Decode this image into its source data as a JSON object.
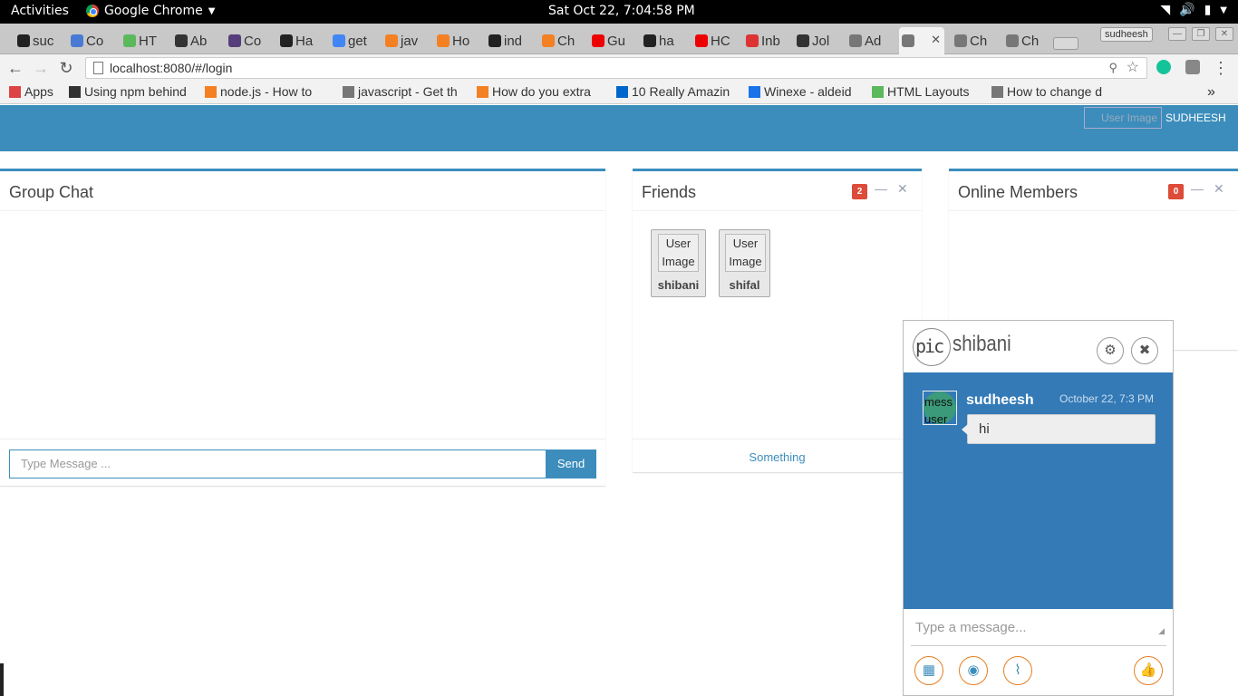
{
  "system": {
    "activities": "Activities",
    "app_name": "Google Chrome",
    "clock": "Sat Oct 22,  7:04:58 PM"
  },
  "tabs": [
    {
      "label": "suc",
      "icon": "github-icon",
      "color": "#222"
    },
    {
      "label": "Co",
      "icon": "bootstrap-icon",
      "color": "#4a7bd4"
    },
    {
      "label": "HT",
      "icon": "html-layouts-icon",
      "color": "#5cb85c"
    },
    {
      "label": "Ab",
      "icon": "codepen-icon",
      "color": "#333"
    },
    {
      "label": "Co",
      "icon": "bootstrap-b-icon",
      "color": "#563d7c"
    },
    {
      "label": "Ha",
      "icon": "github-icon",
      "color": "#222"
    },
    {
      "label": "get",
      "icon": "google-icon",
      "color": "#4285f4"
    },
    {
      "label": "jav",
      "icon": "stackoverflow-icon",
      "color": "#f48024"
    },
    {
      "label": "Ho",
      "icon": "stackoverflow-icon",
      "color": "#f48024"
    },
    {
      "label": "ind",
      "icon": "github-icon",
      "color": "#222"
    },
    {
      "label": "Ch",
      "icon": "stackoverflow-icon",
      "color": "#f48024"
    },
    {
      "label": "Gu",
      "icon": "youtube-icon",
      "color": "#e00"
    },
    {
      "label": "ha",
      "icon": "github-icon",
      "color": "#222"
    },
    {
      "label": "HC",
      "icon": "youtube-icon",
      "color": "#e00"
    },
    {
      "label": "Inb",
      "icon": "gmail-icon",
      "color": "#d33"
    },
    {
      "label": "Jol",
      "icon": "angellist-icon",
      "color": "#333"
    },
    {
      "label": "Ad",
      "icon": "page-icon",
      "color": "#777"
    },
    {
      "label": "",
      "icon": "page-icon",
      "color": "#777",
      "active": true
    },
    {
      "label": "Ch",
      "icon": "page-icon",
      "color": "#777"
    },
    {
      "label": "Ch",
      "icon": "page-icon",
      "color": "#777"
    }
  ],
  "profile_name": "sudheesh",
  "url": "localhost:8080/#/login",
  "bookmarks": [
    {
      "label": "Apps",
      "icon": "apps-grid-icon"
    },
    {
      "label": "Using npm behind",
      "icon": "npm-icon"
    },
    {
      "label": "node.js - How to",
      "icon": "stackoverflow-icon"
    },
    {
      "label": "javascript - Get th",
      "icon": "page-icon"
    },
    {
      "label": "How do you extra",
      "icon": "stackoverflow-icon"
    },
    {
      "label": "10 Really Amazin",
      "icon": "flag-icon"
    },
    {
      "label": "Winexe - aldeid",
      "icon": "aldeid-icon"
    },
    {
      "label": "HTML Layouts",
      "icon": "html-layouts-icon"
    },
    {
      "label": "How to change d",
      "icon": "page-icon"
    }
  ],
  "header": {
    "user_image_alt": "User Image",
    "user_name": "SUDHEESH"
  },
  "group_chat": {
    "title": "Group Chat",
    "placeholder": "Type Message ...",
    "send_label": "Send"
  },
  "friends": {
    "title": "Friends",
    "badge": "2",
    "items": [
      {
        "image_alt": "User Image",
        "name": "shibani"
      },
      {
        "image_alt": "User Image",
        "name": "shifal"
      }
    ],
    "footer_link": "Something"
  },
  "online": {
    "title": "Online Members",
    "badge": "0"
  },
  "chat_popup": {
    "pic_alt": "pic",
    "name": "shibani",
    "message": {
      "avatar_alt": "mess user",
      "sender": "sudheesh",
      "time": "October 22, 7:3 PM",
      "text": "hi"
    },
    "placeholder": "Type a message..."
  },
  "colors": {
    "primary": "#3c8dbc",
    "danger": "#dd4b39",
    "popup_body": "#337ab7",
    "action_border": "#e67e22"
  }
}
